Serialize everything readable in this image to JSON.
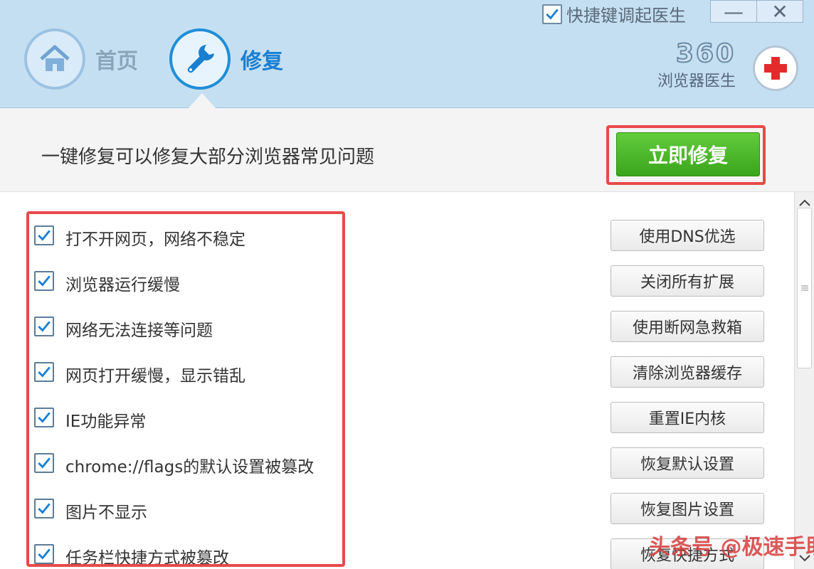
{
  "window": {
    "hotkey_checkbox_label": "快捷键调起医生",
    "hotkey_checked": true,
    "minimize_label": "—",
    "close_label": "✕"
  },
  "nav": {
    "home_label": "首页",
    "repair_label": "修复",
    "active": "修复"
  },
  "brand": {
    "number": "360",
    "name": "浏览器医生"
  },
  "banner": {
    "text": "一键修复可以修复大部分浏览器常见问题",
    "fix_button": "立即修复"
  },
  "items": [
    {
      "label": "打不开网页，网络不稳定",
      "checked": true,
      "action": "使用DNS优选"
    },
    {
      "label": "浏览器运行缓慢",
      "checked": true,
      "action": "关闭所有扩展"
    },
    {
      "label": "网络无法连接等问题",
      "checked": true,
      "action": "使用断网急救箱"
    },
    {
      "label": "网页打开缓慢，显示错乱",
      "checked": true,
      "action": "清除浏览器缓存"
    },
    {
      "label": "IE功能异常",
      "checked": true,
      "action": "重置IE内核"
    },
    {
      "label": "chrome://flags的默认设置被篡改",
      "checked": true,
      "action": "恢复默认设置"
    },
    {
      "label": "图片不显示",
      "checked": true,
      "action": "恢复图片设置"
    },
    {
      "label": "任务栏快捷方式被篡改",
      "checked": true,
      "action": "恢复快捷方式"
    }
  ],
  "watermark": "头条号 @极速手助",
  "colors": {
    "header_bg": "#c5dff2",
    "accent_blue": "#1a7fd1",
    "fix_green": "#3aa51c",
    "highlight_red": "#e84a4a",
    "check_blue": "#1a7fd1"
  }
}
